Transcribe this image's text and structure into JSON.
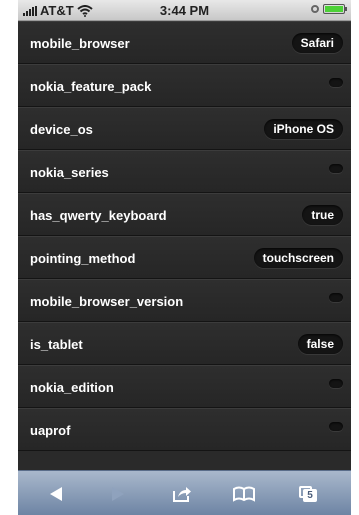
{
  "status_bar": {
    "carrier": "AT&T",
    "time": "3:44 PM"
  },
  "properties": [
    {
      "label": "mobile_browser",
      "value": "Safari"
    },
    {
      "label": "nokia_feature_pack",
      "value": ""
    },
    {
      "label": "device_os",
      "value": "iPhone OS"
    },
    {
      "label": "nokia_series",
      "value": ""
    },
    {
      "label": "has_qwerty_keyboard",
      "value": "true"
    },
    {
      "label": "pointing_method",
      "value": "touchscreen"
    },
    {
      "label": "mobile_browser_version",
      "value": ""
    },
    {
      "label": "is_tablet",
      "value": "false"
    },
    {
      "label": "nokia_edition",
      "value": ""
    },
    {
      "label": "uaprof",
      "value": ""
    }
  ],
  "toolbar": {
    "tabs_count": "5",
    "icons": [
      "back-arrow-icon",
      "forward-arrow-icon",
      "share-icon",
      "bookmarks-icon",
      "tabs-icon"
    ]
  },
  "colors": {
    "row_background": "#2a2a2a",
    "pill_background": "#141414",
    "toolbar_top": "#a9b8cc",
    "toolbar_bottom": "#6c83a3",
    "battery": "#4cd137"
  }
}
